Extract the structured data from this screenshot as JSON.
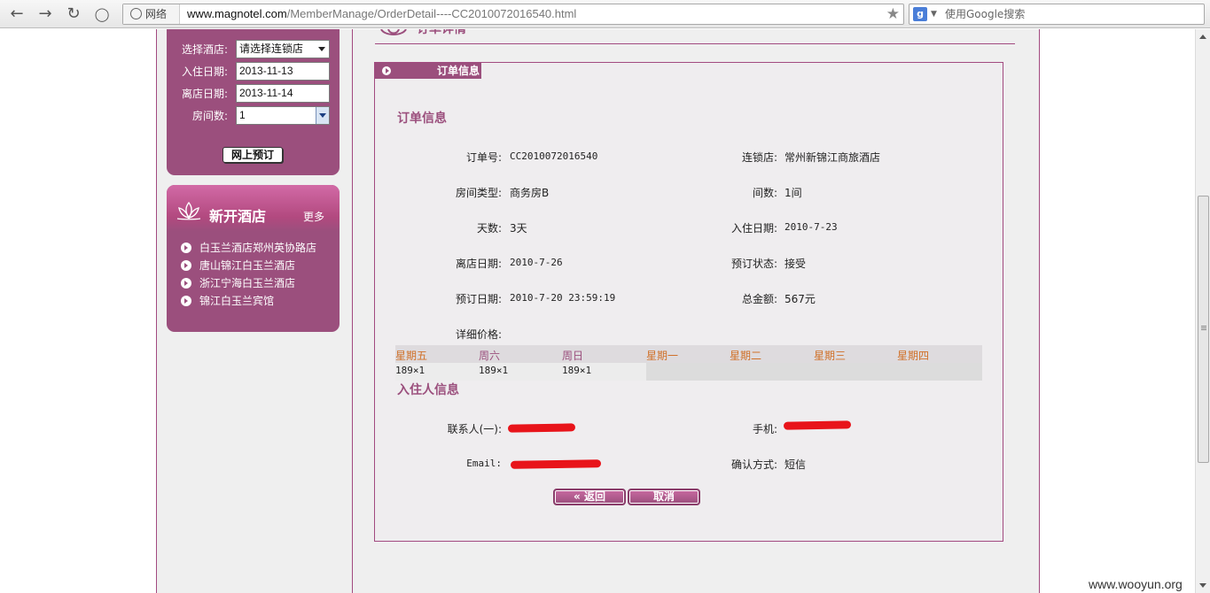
{
  "browser": {
    "site_badge": "网络",
    "url_domain": "www.magnotel.com",
    "url_path": "/MemberManage/OrderDetail----CC2010072016540.html",
    "search_placeholder": "使用Google搜索",
    "search_logo": "g"
  },
  "booking_form": {
    "hotel_label": "选择酒店:",
    "hotel_value": "请选择连锁店",
    "checkin_label": "入住日期:",
    "checkin_value": "2013-11-13",
    "checkout_label": "离店日期:",
    "checkout_value": "2013-11-14",
    "rooms_label": "房间数:",
    "rooms_value": "1",
    "book_button": "网上预订"
  },
  "new_hotels": {
    "title": "新开酒店",
    "more": "更多",
    "items": [
      "白玉兰酒店郑州英协路店",
      "唐山锦江白玉兰酒店",
      "浙江宁海白玉兰酒店",
      "锦江白玉兰宾馆"
    ]
  },
  "content": {
    "top_title": "订单详情",
    "box_tab": "订单信息",
    "order_section_title": "订单信息",
    "guest_section_title": "入住人信息"
  },
  "order": {
    "order_no_label": "订单号:",
    "order_no": "CC2010072016540",
    "chain_label": "连锁店:",
    "chain": "常州新锦江商旅酒店",
    "room_type_label": "房间类型:",
    "room_type": "商务房B",
    "room_count_label": "间数:",
    "room_count": "1间",
    "days_label": "天数:",
    "days": "3天",
    "checkin_label": "入住日期:",
    "checkin": "2010-7-23",
    "checkout_label": "离店日期:",
    "checkout": "2010-7-26",
    "status_label": "预订状态:",
    "status": "接受",
    "booked_label": "预订日期:",
    "booked": "2010-7-20 23:59:19",
    "total_label": "总金额:",
    "total": "567元",
    "detail_price_label": "详细价格:"
  },
  "price_table": {
    "days": [
      "星期五",
      "周六",
      "周日",
      "星期一",
      "星期二",
      "星期三",
      "星期四"
    ],
    "prices": [
      "189×1",
      "189×1",
      "189×1",
      "",
      "",
      "",
      ""
    ]
  },
  "guest": {
    "contact_label": "联系人(一):",
    "phone_label": "手机:",
    "email_label": "Email:",
    "confirm_label": "确认方式:",
    "confirm_value": "短信"
  },
  "buttons": {
    "back": "« 返回",
    "cancel": "取消"
  },
  "watermark": "www.wooyun.org",
  "colors": {
    "brand": "#9b4f7d",
    "accent_border": "#a24a80",
    "weekday_orange": "#d07028",
    "redaction": "#e8141a"
  }
}
